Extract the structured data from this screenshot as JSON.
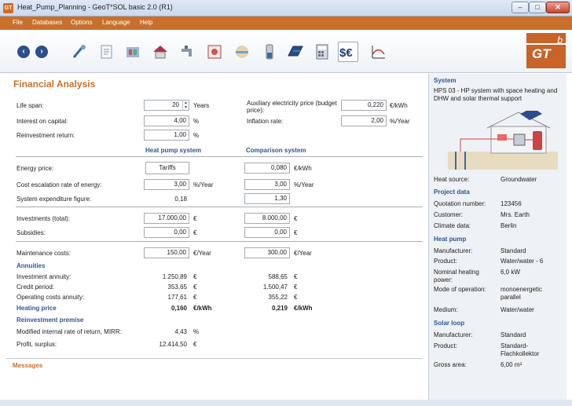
{
  "window": {
    "title": "Heat_Pump_Planning - GeoT*SOL basic 2.0 (R1)",
    "app_icon": "GT"
  },
  "menu": [
    "File",
    "Databases",
    "Options",
    "Language",
    "Help"
  ],
  "logo": {
    "text": "GT",
    "superscript": "b"
  },
  "main": {
    "title": "Financial Analysis",
    "life_span": {
      "label": "Life span:",
      "value": "20",
      "unit": "Years"
    },
    "interest": {
      "label": "Interest on capital:",
      "value": "4,00",
      "unit": "%"
    },
    "reinvest": {
      "label": "Reinvestment return:",
      "value": "1,00",
      "unit": "%"
    },
    "aux_price": {
      "label": "Auxiliary electricity price (budget price):",
      "value": "0,220",
      "unit": "€/kWh"
    },
    "inflation": {
      "label": "Inflation rate:",
      "value": "2,00",
      "unit": "%/Year"
    },
    "col_hp": "Heat pump system",
    "col_cmp": "Comparison system",
    "energy_price": {
      "label": "Energy price:",
      "hp_button": "Tariffs",
      "cmp_value": "0,080",
      "unit": "€/kWh"
    },
    "escalation": {
      "label": "Cost escalation rate of energy:",
      "hp_value": "3,00",
      "hp_unit": "%/Year",
      "cmp_value": "3,00",
      "cmp_unit": "%/Year"
    },
    "sys_exp": {
      "label": "System expenditure figure:",
      "hp_value": "0,18",
      "cmp_value": "1,30"
    },
    "investments": {
      "label": "Investments (total):",
      "hp_value": "17.000,00",
      "cmp_value": "8.000,00",
      "unit": "€"
    },
    "subsidies": {
      "label": "Subsidies:",
      "hp_value": "0,00",
      "cmp_value": "0,00",
      "unit": "€"
    },
    "maintenance": {
      "label": "Maintenance costs:",
      "hp_value": "150,00",
      "cmp_value": "300,00",
      "unit": "€/Year"
    },
    "annuities": {
      "heading": "Annuities",
      "investment": {
        "label": "Investment annuity:",
        "hp": "1.250,89",
        "cmp": "588,65",
        "unit": "€"
      },
      "credit": {
        "label": "Credit period:",
        "hp": "353,65",
        "cmp": "1.500,47",
        "unit": "€"
      },
      "operating": {
        "label": "Operating costs annuity:",
        "hp": "177,61",
        "cmp": "355,22",
        "unit": "€"
      }
    },
    "heating_price": {
      "label": "Heating price",
      "hp": "0,160",
      "cmp": "0,219",
      "unit": "€/kWh"
    },
    "reinvest_premise": {
      "heading": "Reinvestment premise",
      "mirr": {
        "label": "Modified internal rate of return, MIRR:",
        "value": "4,43",
        "unit": "%"
      },
      "profit": {
        "label": "Profit, surplus:",
        "value": "12.414,50",
        "unit": "€"
      }
    },
    "messages": "Messages"
  },
  "side": {
    "system_heading": "System",
    "system_desc": "HPS 03 - HP system with space heating and DHW and solar thermal support",
    "heat_source": {
      "k": "Heat source:",
      "v": "Groundwater"
    },
    "project_heading": "Project data",
    "quotation": {
      "k": "Quotation number:",
      "v": "123456"
    },
    "customer": {
      "k": "Customer:",
      "v": "Mrs. Earth"
    },
    "climate": {
      "k": "Climate data:",
      "v": "Berlin"
    },
    "hp_heading": "Heat pump",
    "hp_manufacturer": {
      "k": "Manufacturer:",
      "v": "Standard"
    },
    "hp_product": {
      "k": "Product:",
      "v": "Water/water - 6"
    },
    "hp_nominal": {
      "k": "Nominal heating power:",
      "v": "6,0 kW"
    },
    "hp_mode": {
      "k": "Mode of operation:",
      "v": "monoenergetic parallel"
    },
    "hp_medium": {
      "k": "Medium:",
      "v": "Water/water"
    },
    "solar_heading": "Solar loop",
    "sl_manufacturer": {
      "k": "Manufacturer:",
      "v": "Standard"
    },
    "sl_product": {
      "k": "Product:",
      "v": "Standard-Flachkollektor"
    },
    "sl_area": {
      "k": "Gross area:",
      "v": "6,00 m²"
    }
  }
}
